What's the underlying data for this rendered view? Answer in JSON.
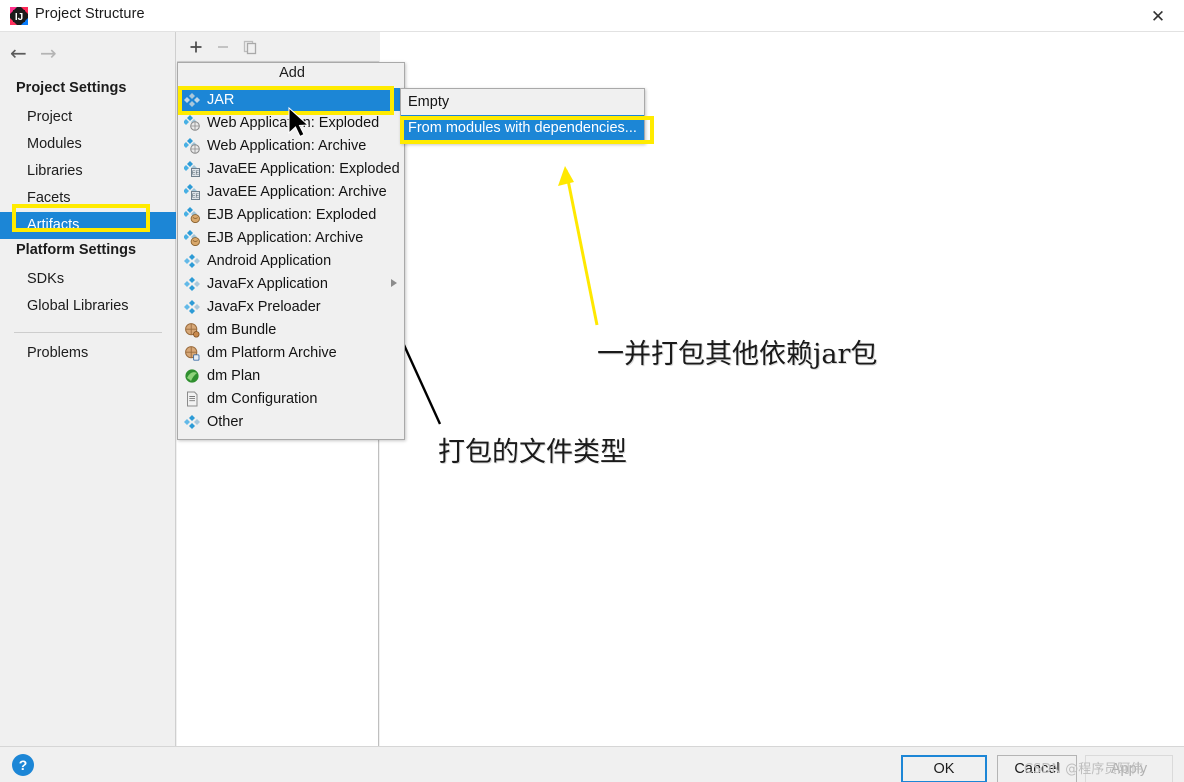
{
  "window": {
    "title": "Project Structure",
    "app_icon": "intellij-idea-icon",
    "close_label": "✕"
  },
  "navigation": {
    "back_icon": "←",
    "forward_icon": "→"
  },
  "sidebar": {
    "sections": [
      {
        "heading": "Project Settings",
        "items": [
          {
            "label": "Project",
            "selected": false
          },
          {
            "label": "Modules",
            "selected": false
          },
          {
            "label": "Libraries",
            "selected": false
          },
          {
            "label": "Facets",
            "selected": false
          },
          {
            "label": "Artifacts",
            "selected": true
          }
        ]
      },
      {
        "heading": "Platform Settings",
        "items": [
          {
            "label": "SDKs",
            "selected": false
          },
          {
            "label": "Global Libraries",
            "selected": false
          }
        ]
      }
    ],
    "problems_label": "Problems"
  },
  "toolbar": {
    "add_icon": "+",
    "remove_icon": "−",
    "copy_icon": "copy-icon"
  },
  "add_menu": {
    "title": "Add",
    "items": [
      {
        "label": "JAR",
        "icon": "jar-icon",
        "selected": true,
        "submenu": false
      },
      {
        "label": "Web Application: Exploded",
        "icon": "web-exploded-icon",
        "selected": false,
        "submenu": false
      },
      {
        "label": "Web Application: Archive",
        "icon": "web-archive-icon",
        "selected": false,
        "submenu": false
      },
      {
        "label": "JavaEE Application: Exploded",
        "icon": "javaee-exploded-icon",
        "selected": false,
        "submenu": false
      },
      {
        "label": "JavaEE Application: Archive",
        "icon": "javaee-archive-icon",
        "selected": false,
        "submenu": false
      },
      {
        "label": "EJB Application: Exploded",
        "icon": "ejb-exploded-icon",
        "selected": false,
        "submenu": false
      },
      {
        "label": "EJB Application: Archive",
        "icon": "ejb-archive-icon",
        "selected": false,
        "submenu": false
      },
      {
        "label": "Android Application",
        "icon": "android-application-icon",
        "selected": false,
        "submenu": false
      },
      {
        "label": "JavaFx Application",
        "icon": "javafx-application-icon",
        "selected": false,
        "submenu": true
      },
      {
        "label": "JavaFx Preloader",
        "icon": "javafx-preloader-icon",
        "selected": false,
        "submenu": false
      },
      {
        "label": "dm Bundle",
        "icon": "dm-bundle-icon",
        "selected": false,
        "submenu": false
      },
      {
        "label": "dm Platform Archive",
        "icon": "dm-platform-archive-icon",
        "selected": false,
        "submenu": false
      },
      {
        "label": "dm Plan",
        "icon": "dm-plan-icon",
        "selected": false,
        "submenu": false
      },
      {
        "label": "dm Configuration",
        "icon": "dm-configuration-icon",
        "selected": false,
        "submenu": false
      },
      {
        "label": "Other",
        "icon": "other-icon",
        "selected": false,
        "submenu": false
      }
    ]
  },
  "jar_submenu": {
    "items": [
      {
        "label": "Empty",
        "selected": false
      },
      {
        "label": "From modules with dependencies...",
        "selected": true
      }
    ]
  },
  "annotations": [
    {
      "text": "一并打包其他依赖jar包"
    },
    {
      "text": "打包的文件类型"
    }
  ],
  "footer": {
    "help_label": "?",
    "buttons": [
      {
        "label": "OK",
        "state": "default"
      },
      {
        "label": "Cancel",
        "state": "normal"
      },
      {
        "label": "Apply",
        "state": "disabled"
      }
    ],
    "watermark": "CSDN @程序员阿伟"
  },
  "colors": {
    "selection_blue": "#1c86d6",
    "highlight_yellow": "#ffeb00",
    "panel_gray": "#f0f0f0",
    "annotation_arrow_yellow": "#ffe800",
    "annotation_arrow_black": "#000000"
  }
}
